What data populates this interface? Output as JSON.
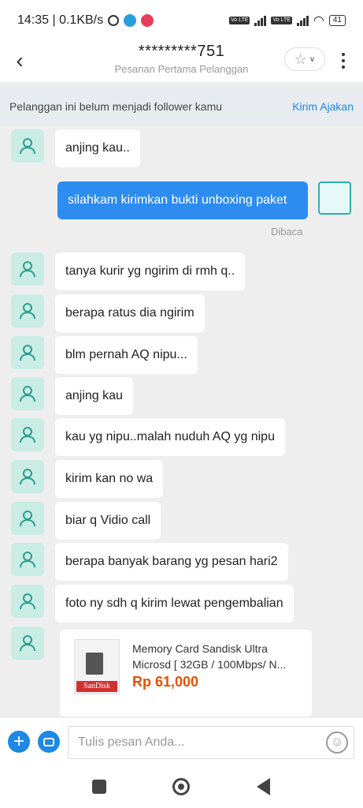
{
  "status_bar": {
    "time_speed": "14:35 | 0.1KB/s",
    "lte_1": "Vo LTE",
    "lte_2": "Vo LTE",
    "battery": "41"
  },
  "header": {
    "title": "*********751",
    "subtitle": "Pesanan Pertama Pelanggan"
  },
  "banner": {
    "text": "Pelanggan ini belum menjadi follower kamu",
    "action": "Kirim Ajakan"
  },
  "messages": [
    {
      "text": "anjing kau.."
    },
    {
      "text": "silahkam kirimkan bukti unboxing paket",
      "status": "Dibaca"
    },
    {
      "text": "tanya kurir yg ngirim di rmh q.."
    },
    {
      "text": "berapa ratus dia ngirim"
    },
    {
      "text": "blm pernah AQ nipu..."
    },
    {
      "text": "anjing kau"
    },
    {
      "text": "kau yg nipu..malah nuduh AQ yg nipu"
    },
    {
      "text": "kirim kan no wa"
    },
    {
      "text": "biar q Vidio call"
    },
    {
      "text": "berapa banyak barang yg pesan hari2"
    },
    {
      "text": "foto ny sdh q kirim lewat pengembalian"
    }
  ],
  "product": {
    "name": "Memory Card Sandisk Ultra Microsd [ 32GB / 100Mbps/ N...",
    "price": "Rp 61,000",
    "image_brand": "SanDisk"
  },
  "input": {
    "placeholder": "Tulis pesan Anda..."
  },
  "colors": {
    "accent": "#1e88e5",
    "outgoing_bubble": "#2d8cf0",
    "avatar_bg": "#c9ece5",
    "price": "#e65100"
  }
}
